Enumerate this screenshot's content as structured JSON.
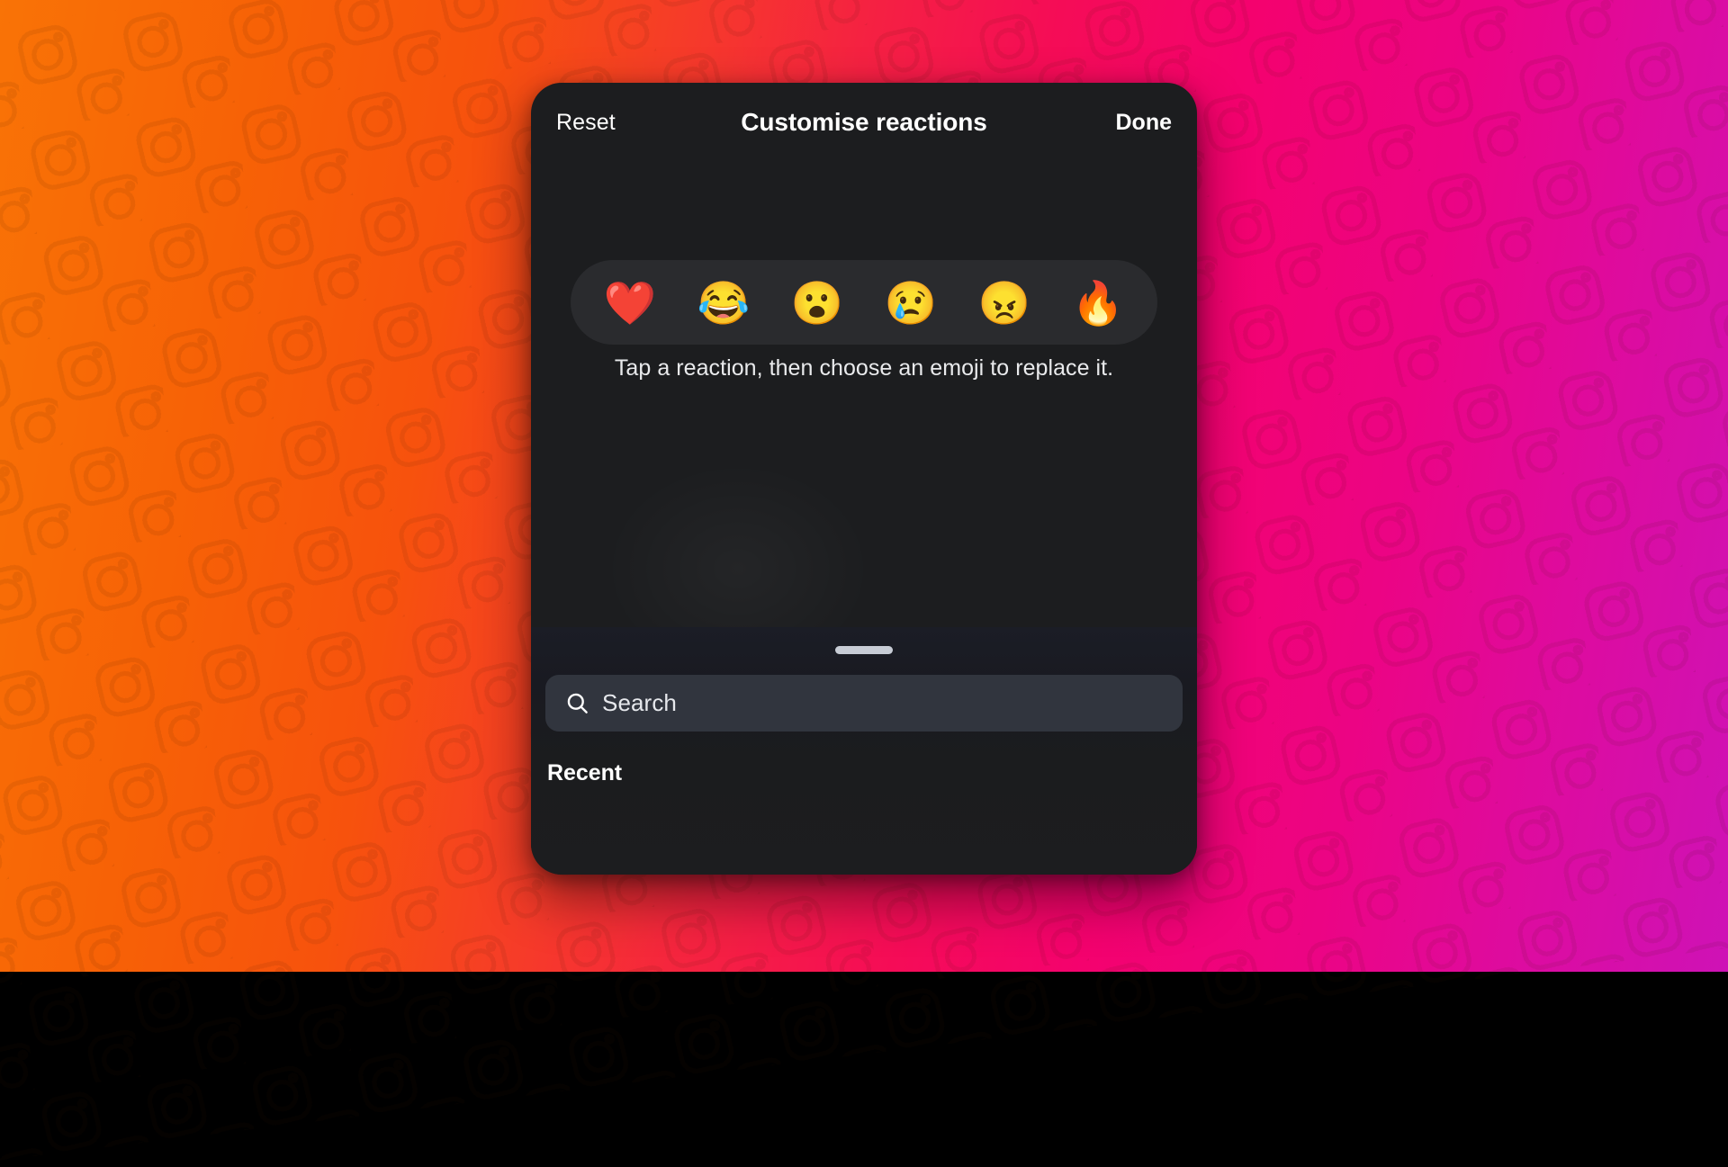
{
  "wallpaper": {
    "gradient_from": "#F97306",
    "gradient_mid": "#F50C57",
    "gradient_to": "#CE12B6",
    "pattern_icon": "instagram-camera-glyph"
  },
  "sheet": {
    "background_color": "#1c1d1f",
    "header": {
      "reset_label": "Reset",
      "title": "Customise reactions",
      "done_label": "Done"
    },
    "reaction_tray": {
      "background_color": "#2a2b2e",
      "reactions": [
        {
          "emoji": "❤️",
          "name": "red-heart"
        },
        {
          "emoji": "😂",
          "name": "face-with-tears-of-joy"
        },
        {
          "emoji": "😮",
          "name": "face-with-open-mouth"
        },
        {
          "emoji": "😢",
          "name": "crying-face"
        },
        {
          "emoji": "😠",
          "name": "angry-face"
        },
        {
          "emoji": "🔥",
          "name": "fire"
        }
      ]
    },
    "hint_text": "Tap a reaction, then choose an emoji to replace it."
  },
  "keyboard": {
    "drag_handle_color": "#c7ccd5",
    "search": {
      "icon": "search-icon",
      "placeholder": "Search",
      "value": "",
      "background_color": "#31353e"
    },
    "recent_label": "Recent",
    "recent_emojis": []
  }
}
